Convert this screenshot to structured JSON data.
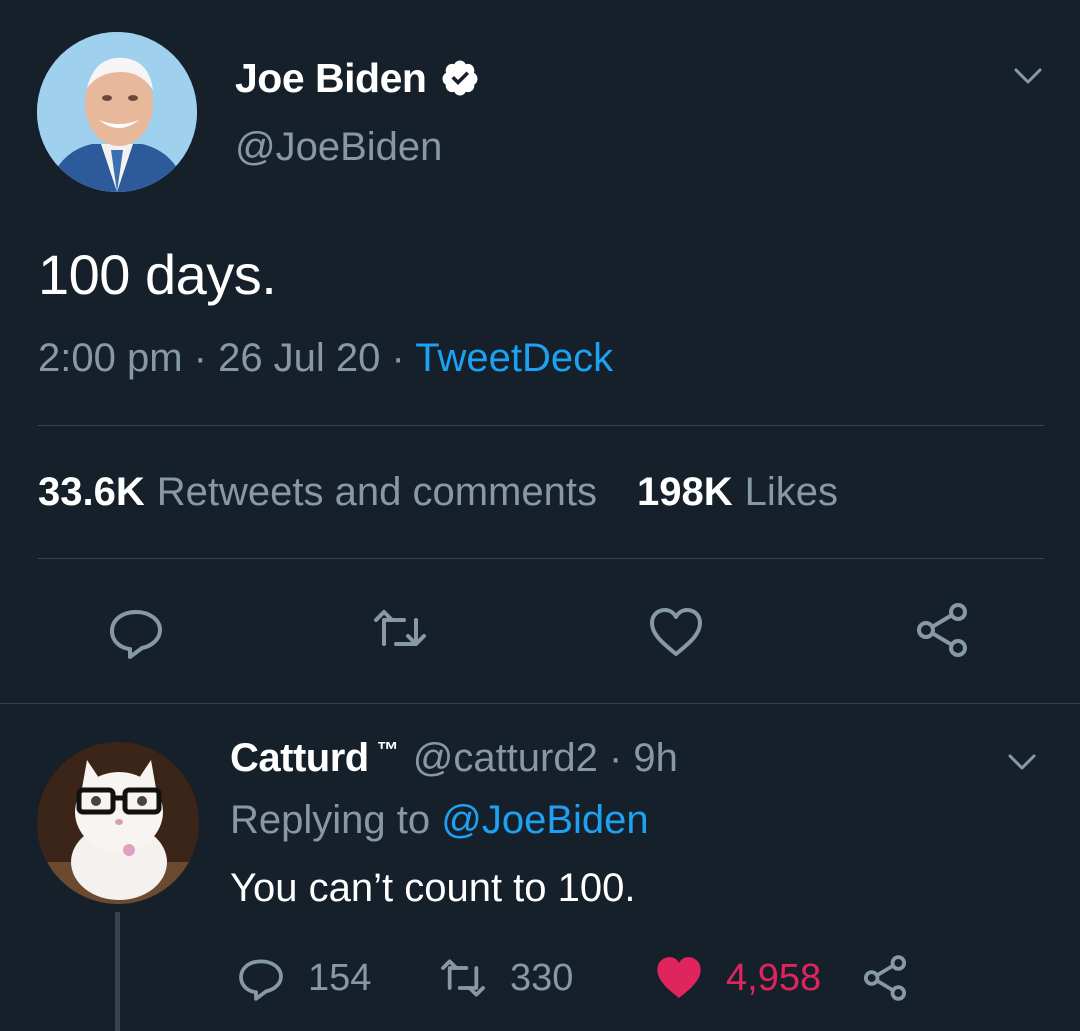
{
  "colors": {
    "background": "#15202b",
    "text_primary": "#ffffff",
    "text_secondary": "#8899a6",
    "link": "#1da1f2",
    "like": "#e0245e",
    "divider": "#38444d"
  },
  "main_tweet": {
    "author_name": "Joe Biden",
    "author_handle": "@JoeBiden",
    "verified_icon": "verified-badge-icon",
    "text": "100 days.",
    "time": "2:00 pm",
    "separator": " · ",
    "date": "26 Jul 20",
    "source": "TweetDeck",
    "stats": {
      "retweets_count": "33.6K",
      "retweets_label": "Retweets and comments",
      "likes_count": "198K",
      "likes_label": "Likes"
    },
    "actions": [
      "reply-icon",
      "retweet-icon",
      "like-icon",
      "share-icon"
    ]
  },
  "reply_tweet": {
    "author_name": "Catturd",
    "author_tm": "™",
    "author_handle": "@catturd2 · 9h",
    "replying_prefix": "Replying to ",
    "replying_mention": "@JoeBiden",
    "text": "You can’t count to 100.",
    "reply_count": "154",
    "retweet_count": "330",
    "like_count": "4,958",
    "liked": true
  }
}
